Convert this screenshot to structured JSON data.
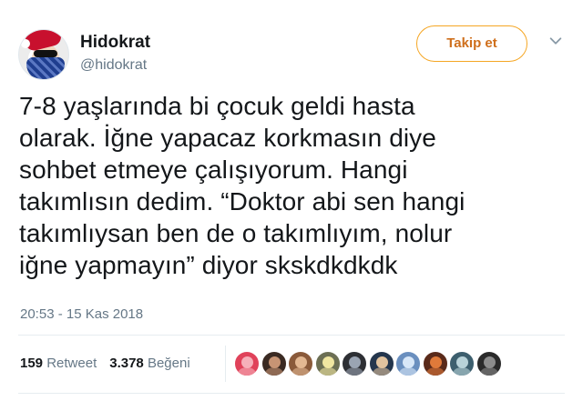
{
  "user": {
    "display_name": "Hidokrat",
    "handle": "@hidokrat",
    "avatar_icon": "santa-hat-bandana-avatar"
  },
  "actions": {
    "follow_label": "Takip et",
    "more_icon": "chevron-down-icon"
  },
  "tweet": {
    "text": "7-8 yaşlarında bi çocuk geldi hasta\nolarak. İğne yapacaz korkmasın diye\nsohbet etmeye çalışıyorum. Hangi\ntakımlısın dedim. “Doktor abi sen hangi\ntakımlıysan ben de o takımlıyım, nolur\niğne yapmayın” diyor skskdkdkdk",
    "timestamp": "20:53 - 15 Kas 2018"
  },
  "stats": {
    "retweet_count": "159",
    "retweet_label": "Retweet",
    "like_count": "3.378",
    "like_label": "Beğeni"
  },
  "likers": [
    {
      "color": "#e0425a",
      "accent": "#f6b0ba"
    },
    {
      "color": "#3a2a22",
      "accent": "#c79474"
    },
    {
      "color": "#8a5a3a",
      "accent": "#e3b892"
    },
    {
      "color": "#6c6f54",
      "accent": "#f0e6a1"
    },
    {
      "color": "#2d2f34",
      "accent": "#9aa4b3"
    },
    {
      "color": "#24364d",
      "accent": "#e1c39f"
    },
    {
      "color": "#6a8fbf",
      "accent": "#d8e7f8"
    },
    {
      "color": "#5a2a1a",
      "accent": "#e07a3a"
    },
    {
      "color": "#3d5f6e",
      "accent": "#b9d3d9"
    },
    {
      "color": "#2a2a2a",
      "accent": "#8c8c8c"
    }
  ],
  "colors": {
    "follow_border": "#f5a623",
    "follow_text": "#cf6f1c",
    "secondary_text": "#657786",
    "primary_text": "#14171a"
  }
}
